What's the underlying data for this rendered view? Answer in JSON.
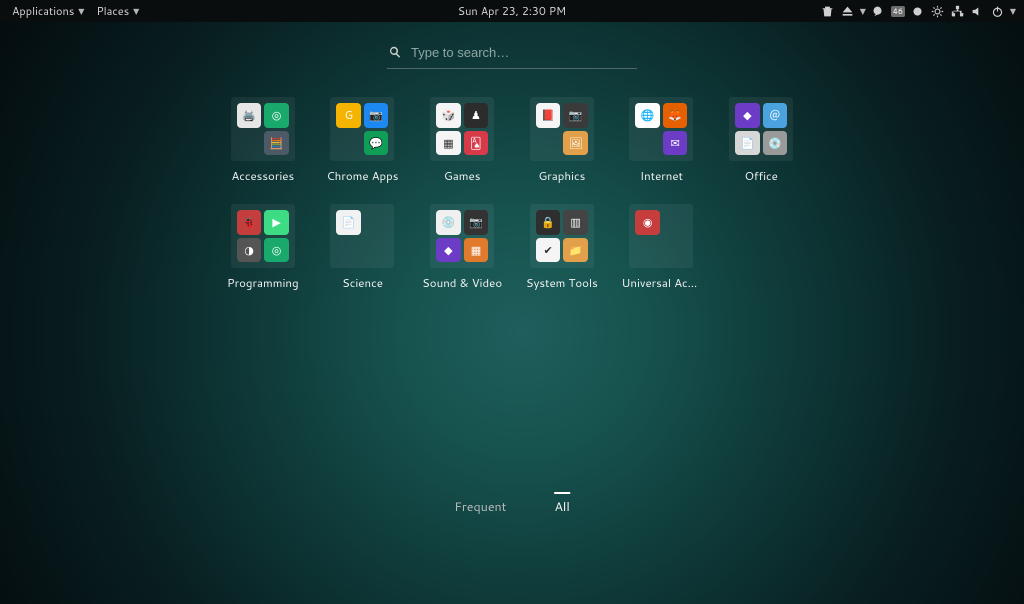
{
  "topbar": {
    "applications_label": "Applications",
    "places_label": "Places",
    "datetime": "Sun Apr 23,  2:30 PM",
    "battery_badge": "46"
  },
  "search": {
    "placeholder": "Type to search…",
    "value": ""
  },
  "categories": [
    {
      "id": "accessories",
      "label": "Accessories",
      "minis": [
        {
          "name": "printer-icon",
          "bg": "#e6e6e6",
          "emoji": "🖨️"
        },
        {
          "name": "globe-green-icon",
          "bg": "#1aa96c",
          "emoji": "◎"
        },
        {
          "name": "blank-icon",
          "bg": "transparent",
          "emoji": ""
        },
        {
          "name": "calculator-icon",
          "bg": "#4b5a66",
          "emoji": "🧮"
        }
      ]
    },
    {
      "id": "chrome-apps",
      "label": "Chrome Apps",
      "minis": [
        {
          "name": "g-icon",
          "bg": "#f4b400",
          "emoji": "G"
        },
        {
          "name": "camera-blue-icon",
          "bg": "#1e88f2",
          "emoji": "📷"
        },
        {
          "name": "blank2-icon",
          "bg": "transparent",
          "emoji": ""
        },
        {
          "name": "hangouts-icon",
          "bg": "#0f9d58",
          "emoji": "💬"
        }
      ]
    },
    {
      "id": "games",
      "label": "Games",
      "minis": [
        {
          "name": "dice-icon",
          "bg": "#f5f5f5",
          "emoji": "🎲"
        },
        {
          "name": "chess-icon",
          "bg": "#2c2c2c",
          "emoji": "♟"
        },
        {
          "name": "grid-colors-icon",
          "bg": "#f5f5f5",
          "emoji": "▦"
        },
        {
          "name": "cards-icon",
          "bg": "#d73a49",
          "emoji": "🂡"
        }
      ]
    },
    {
      "id": "graphics",
      "label": "Graphics",
      "minis": [
        {
          "name": "pdf-icon",
          "bg": "#f5f5f5",
          "emoji": "📕"
        },
        {
          "name": "camera-icon",
          "bg": "#3a3a3a",
          "emoji": "📷"
        },
        {
          "name": "blank3-icon",
          "bg": "transparent",
          "emoji": ""
        },
        {
          "name": "folder-image-icon",
          "bg": "#e3a04b",
          "emoji": "🖼"
        }
      ]
    },
    {
      "id": "internet",
      "label": "Internet",
      "minis": [
        {
          "name": "chrome-icon",
          "bg": "#ffffff",
          "emoji": "🌐"
        },
        {
          "name": "firefox-icon",
          "bg": "#e66000",
          "emoji": "🦊"
        },
        {
          "name": "blank4-icon",
          "bg": "transparent",
          "emoji": ""
        },
        {
          "name": "mail-purple-icon",
          "bg": "#6d3cc7",
          "emoji": "✉"
        }
      ]
    },
    {
      "id": "office",
      "label": "Office",
      "minis": [
        {
          "name": "diamond-purple-icon",
          "bg": "#6d3cc7",
          "emoji": "◆"
        },
        {
          "name": "at-icon",
          "bg": "#4aa3df",
          "emoji": "＠"
        },
        {
          "name": "doc-icon",
          "bg": "#d7d7d7",
          "emoji": "📄"
        },
        {
          "name": "disc-icon",
          "bg": "#9a9a9a",
          "emoji": "💿"
        }
      ]
    },
    {
      "id": "programming",
      "label": "Programming",
      "minis": [
        {
          "name": "bug-red-icon",
          "bg": "#c63d3d",
          "emoji": "🐞"
        },
        {
          "name": "android-studio-icon",
          "bg": "#3ddc84",
          "emoji": "▶"
        },
        {
          "name": "unity-icon",
          "bg": "#555",
          "emoji": "◑"
        },
        {
          "name": "globe-green2-icon",
          "bg": "#1aa96c",
          "emoji": "◎"
        }
      ]
    },
    {
      "id": "science",
      "label": "Science",
      "minis": [
        {
          "name": "document-icon",
          "bg": "#f2f2f2",
          "emoji": "📄"
        },
        {
          "name": "blank5-icon",
          "bg": "transparent",
          "emoji": ""
        },
        {
          "name": "blank6-icon",
          "bg": "transparent",
          "emoji": ""
        },
        {
          "name": "blank7-icon",
          "bg": "transparent",
          "emoji": ""
        }
      ]
    },
    {
      "id": "sound-video",
      "label": "Sound & Video",
      "minis": [
        {
          "name": "disc-white-icon",
          "bg": "#f0f0f0",
          "emoji": "💿"
        },
        {
          "name": "cam-dark-icon",
          "bg": "#333",
          "emoji": "📷"
        },
        {
          "name": "diamond-purple2-icon",
          "bg": "#6d3cc7",
          "emoji": "◆"
        },
        {
          "name": "tile-orange-icon",
          "bg": "#e07b2e",
          "emoji": "▦"
        }
      ]
    },
    {
      "id": "system-tools",
      "label": "System Tools",
      "minis": [
        {
          "name": "safe-icon",
          "bg": "#2e2e2e",
          "emoji": "🔒"
        },
        {
          "name": "grid-panel-icon",
          "bg": "#444",
          "emoji": "▥"
        },
        {
          "name": "check-red-icon",
          "bg": "#f5f5f5",
          "emoji": "✔"
        },
        {
          "name": "folder-tools-icon",
          "bg": "#e3a04b",
          "emoji": "📁"
        }
      ]
    },
    {
      "id": "universal-access",
      "label": "Universal Access",
      "minis": [
        {
          "name": "orbs-red-icon",
          "bg": "#c63d3d",
          "emoji": "◉"
        },
        {
          "name": "blank8-icon",
          "bg": "transparent",
          "emoji": ""
        },
        {
          "name": "blank9-icon",
          "bg": "transparent",
          "emoji": ""
        },
        {
          "name": "blank10-icon",
          "bg": "transparent",
          "emoji": ""
        }
      ]
    }
  ],
  "tabs": {
    "frequent": "Frequent",
    "all": "All",
    "active": "all"
  }
}
